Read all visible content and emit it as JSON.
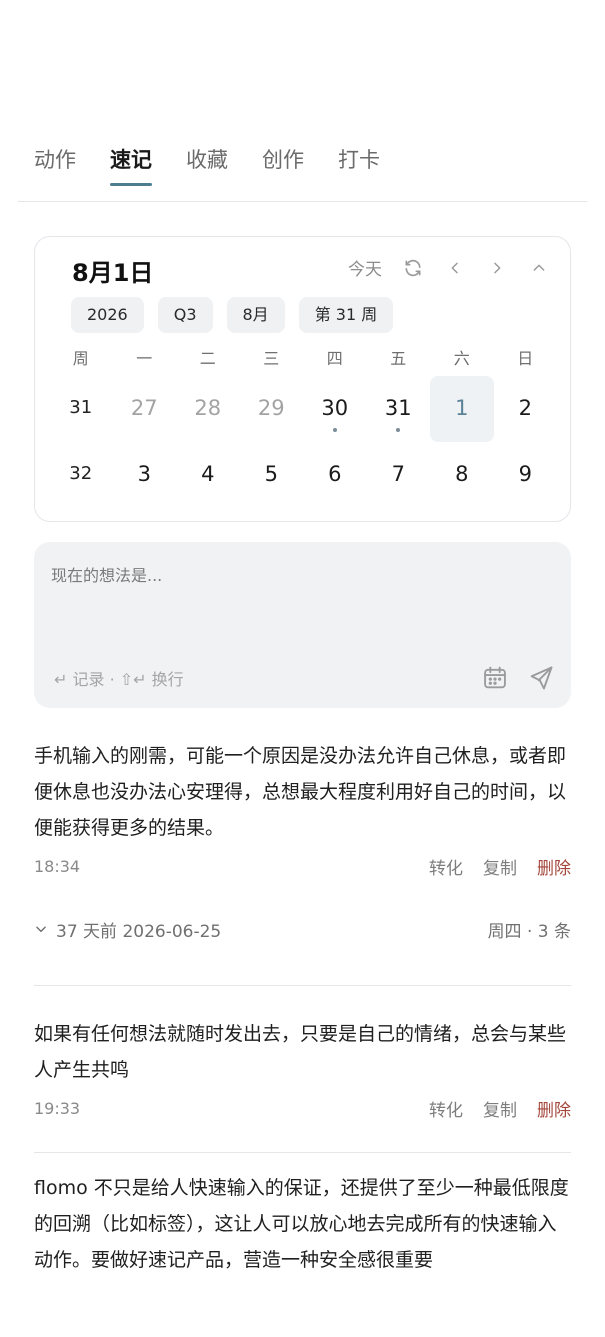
{
  "tabs": [
    {
      "label": "动作"
    },
    {
      "label": "速记",
      "active": true
    },
    {
      "label": "收藏"
    },
    {
      "label": "创作"
    },
    {
      "label": "打卡"
    }
  ],
  "calendar": {
    "title": "8月1日",
    "today_label": "今天",
    "chips": [
      "2026",
      "Q3",
      "8月",
      "第 31 周"
    ],
    "headers": [
      "周",
      "一",
      "二",
      "三",
      "四",
      "五",
      "六",
      "日"
    ],
    "weeks": [
      {
        "week": "31",
        "days": [
          "27",
          "28",
          "29",
          "30",
          "31",
          "1",
          "2"
        ]
      },
      {
        "week": "32",
        "days": [
          "3",
          "4",
          "5",
          "6",
          "7",
          "8",
          "9"
        ]
      }
    ],
    "selected_day": "1",
    "accent_color": "#5b8196"
  },
  "editor": {
    "placeholder": "现在的想法是...",
    "hint": "↵ 记录 · ⇧↵ 换行"
  },
  "memos": [
    {
      "text": "手机输入的刚需，可能一个原因是没办法允许自己休息，或者即便休息也没办法心安理得，总想最大程度利用好自己的时间，以便能获得更多的结果。",
      "time": "18:34",
      "actions": {
        "convert": "转化",
        "copy": "复制",
        "delete": "删除"
      }
    },
    {
      "text": "如果有任何想法就随时发出去，只要是自己的情绪，总会与某些人产生共鸣",
      "time": "19:33",
      "actions": {
        "convert": "转化",
        "copy": "复制",
        "delete": "删除"
      }
    },
    {
      "text": "flomo 不只是给人快速输入的保证，还提供了至少一种最低限度的回溯（比如标签），这让人可以放心地去完成所有的快速输入动作。要做好速记产品，营造一种安全感很重要"
    }
  ],
  "day_group": {
    "label": "37 天前 2026-06-25",
    "summary": "周四 · 3 条"
  },
  "colors": {
    "delete": "#a4473b",
    "tab_indicator": "#4d7d8e"
  }
}
